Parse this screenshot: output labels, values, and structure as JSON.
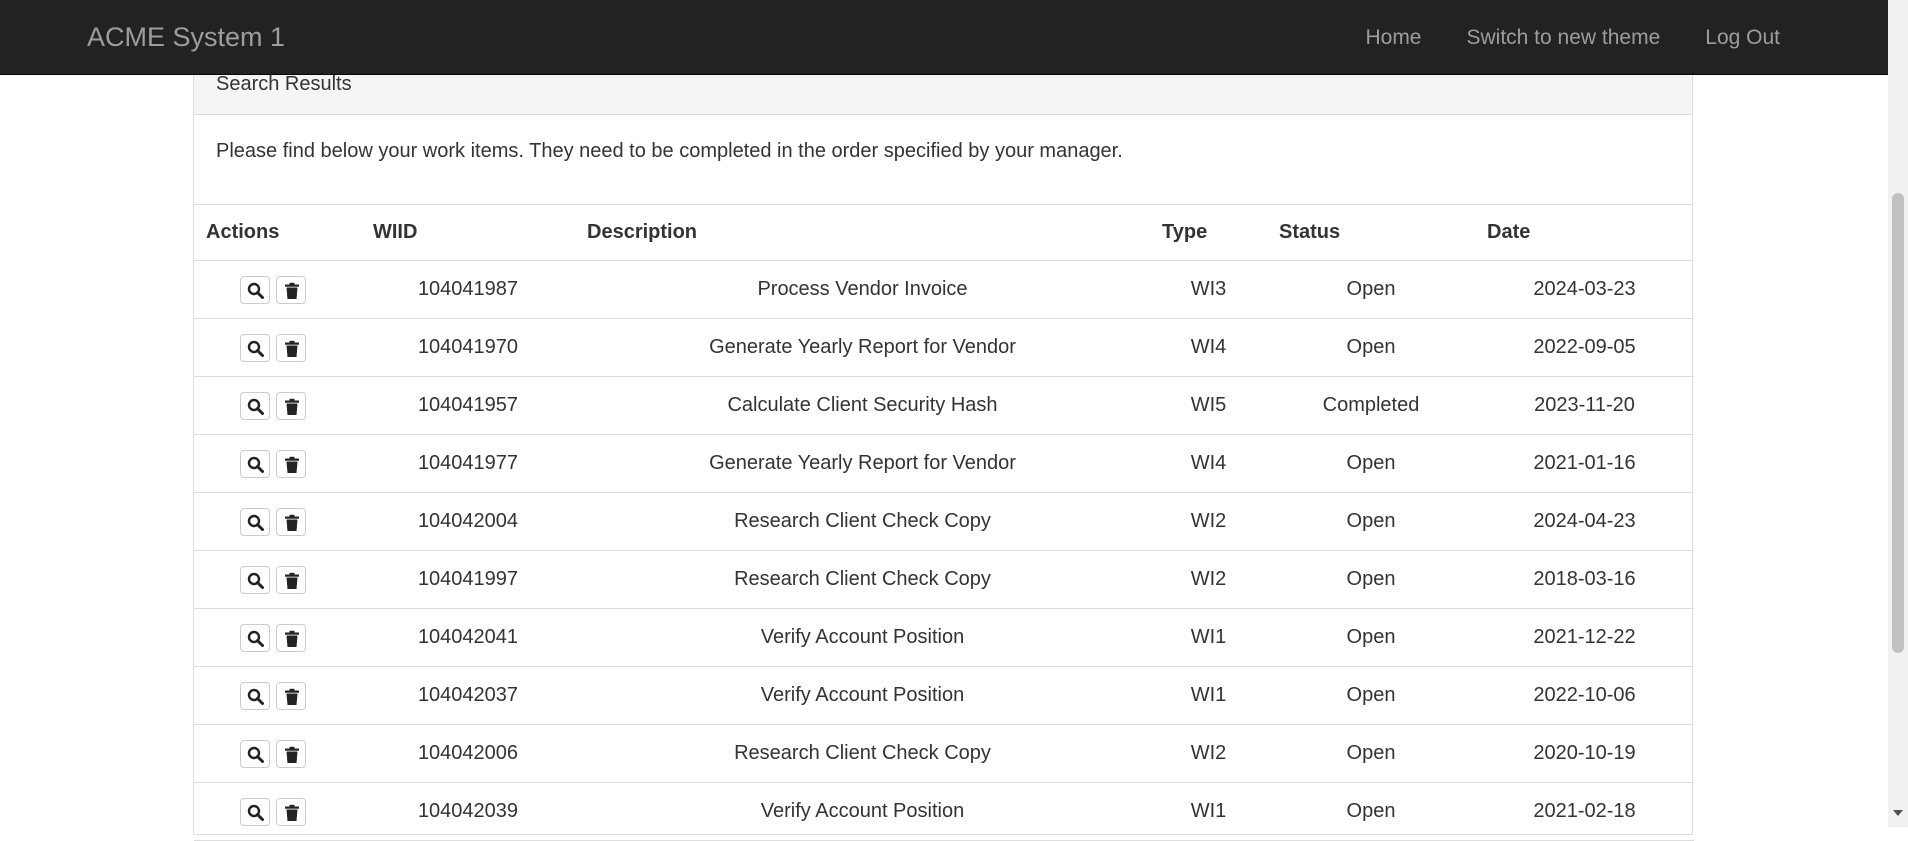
{
  "navbar": {
    "brand": "ACME System 1",
    "links": [
      "Home",
      "Switch to new theme",
      "Log Out"
    ]
  },
  "panel": {
    "title": "Search Results",
    "text": "Please find below your work items. They need to be completed in the order specified by your manager."
  },
  "table": {
    "headers": [
      "Actions",
      "WIID",
      "Description",
      "Type",
      "Status",
      "Date"
    ],
    "rows": [
      {
        "wiid": "104041987",
        "description": "Process Vendor Invoice",
        "type": "WI3",
        "status": "Open",
        "date": "2024-03-23"
      },
      {
        "wiid": "104041970",
        "description": "Generate Yearly Report for Vendor",
        "type": "WI4",
        "status": "Open",
        "date": "2022-09-05"
      },
      {
        "wiid": "104041957",
        "description": "Calculate Client Security Hash",
        "type": "WI5",
        "status": "Completed",
        "date": "2023-11-20"
      },
      {
        "wiid": "104041977",
        "description": "Generate Yearly Report for Vendor",
        "type": "WI4",
        "status": "Open",
        "date": "2021-01-16"
      },
      {
        "wiid": "104042004",
        "description": "Research Client Check Copy",
        "type": "WI2",
        "status": "Open",
        "date": "2024-04-23"
      },
      {
        "wiid": "104041997",
        "description": "Research Client Check Copy",
        "type": "WI2",
        "status": "Open",
        "date": "2018-03-16"
      },
      {
        "wiid": "104042041",
        "description": "Verify Account Position",
        "type": "WI1",
        "status": "Open",
        "date": "2021-12-22"
      },
      {
        "wiid": "104042037",
        "description": "Verify Account Position",
        "type": "WI1",
        "status": "Open",
        "date": "2022-10-06"
      },
      {
        "wiid": "104042006",
        "description": "Research Client Check Copy",
        "type": "WI2",
        "status": "Open",
        "date": "2020-10-19"
      },
      {
        "wiid": "104042039",
        "description": "Verify Account Position",
        "type": "WI1",
        "status": "Open",
        "date": "2021-02-18"
      }
    ]
  },
  "icons": {
    "view": "search-icon",
    "delete": "trash-icon"
  }
}
